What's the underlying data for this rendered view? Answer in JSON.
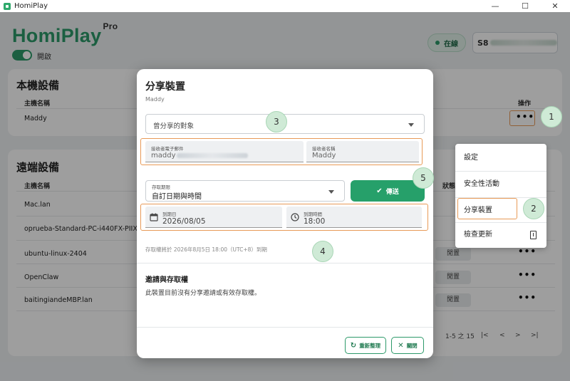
{
  "window": {
    "title": "HomiPlay",
    "controls": [
      "—",
      "☐",
      "✕"
    ]
  },
  "header": {
    "logo": "HomiPlay",
    "logo_suffix": "Pro",
    "toggle_label": "開啟",
    "status": "在線",
    "serial_prefix": "S8"
  },
  "local": {
    "title": "本機設備",
    "col_name": "主機名稱",
    "col_action": "操作",
    "rows": [
      {
        "name": "Maddy",
        "action": "•••"
      }
    ]
  },
  "remote": {
    "title": "遠端設備",
    "col_name": "主機名稱",
    "col_state": "狀態",
    "rows": [
      {
        "name": "Mac.lan",
        "state": "",
        "action": ""
      },
      {
        "name": "oprueba-Standard-PC-i440FX-PIIX",
        "state": "",
        "action": ""
      },
      {
        "name": "ubuntu-linux-2404",
        "state": "閒置",
        "action": "•••"
      },
      {
        "name": "OpenClaw",
        "state": "閒置",
        "action": "•••"
      },
      {
        "name": "baitingiandeMBP.lan",
        "state": "閒置",
        "action": "•••"
      }
    ],
    "pager": {
      "range": "1-5 之 15",
      "first": "|<",
      "prev": "<",
      "next": ">",
      "last": ">|"
    }
  },
  "dialog": {
    "title": "分享裝置",
    "subtitle": "Maddy",
    "recipient_select_placeholder": "曾分享的對象",
    "email_label": "接收者電子郵件",
    "email_value": "maddy",
    "name_label": "接收者名稱",
    "name_value": "Maddy",
    "access_label": "存取期限",
    "access_value": "自訂日期與時間",
    "send_label": "傳送",
    "date_label": "到期日",
    "date_value": "2026/08/05",
    "time_label": "到期時間",
    "time_value": "18:00",
    "expiry_note": "存取權將於 2026年8月5日 18:00（UTC+8）到期",
    "section_title": "邀請與存取權",
    "section_text": "此裝置目前沒有分享邀請或有效存取權。",
    "refresh_label": "重新整理",
    "close_label": "關閉"
  },
  "menu": {
    "items": [
      "設定",
      "安全性活動",
      "分享裝置",
      "檢查更新"
    ]
  },
  "badges": [
    "1",
    "2",
    "3",
    "4",
    "5"
  ],
  "colors": {
    "brand": "#2d9a6a",
    "highlight": "#e89a57",
    "badge": "#cfead6"
  }
}
